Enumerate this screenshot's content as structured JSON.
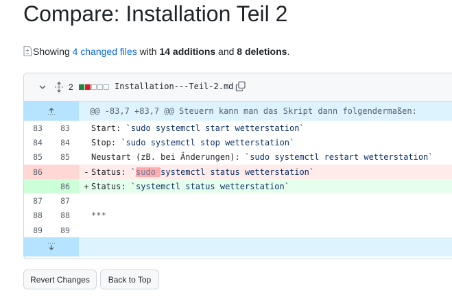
{
  "title": "Compare: Installation Teil 2",
  "summary": {
    "showing": "Showing",
    "changed_files": "4 changed files",
    "with": "with",
    "additions": "14 additions",
    "and": "and",
    "deletions": "8 deletions",
    "period": "."
  },
  "file": {
    "count": "2",
    "name": "Installation---Teil-2.md",
    "diffstat": [
      "add",
      "del",
      "neutral",
      "neutral",
      "neutral"
    ]
  },
  "hunk_header": "@@ -83,7 +83,7 @@ Steuern kann man das Skript dann folgendermaßen:",
  "lines": [
    {
      "type": "context",
      "old": "83",
      "new": "83",
      "sign": " ",
      "pre": "Start: ",
      "code": "`sudo systemctl start wetterstation`"
    },
    {
      "type": "context",
      "old": "84",
      "new": "84",
      "sign": " ",
      "pre": "Stop: ",
      "code": "`sudo systemctl stop wetterstation`"
    },
    {
      "type": "context",
      "old": "85",
      "new": "85",
      "sign": " ",
      "pre": "Neustart (zB. bei Änderungen): ",
      "code": "`sudo systemctl restart wetterstation`"
    },
    {
      "type": "del",
      "old": "86",
      "new": "",
      "sign": "-",
      "pre": "Status: ",
      "code_a": "`",
      "code_hl": "sudo ",
      "code_b": "systemctl status wetterstation`"
    },
    {
      "type": "add",
      "old": "",
      "new": "86",
      "sign": "+",
      "pre": "Status: ",
      "code": "`systemctl status wetterstation`"
    },
    {
      "type": "context",
      "old": "87",
      "new": "87",
      "sign": " ",
      "pre": "",
      "code": ""
    },
    {
      "type": "context",
      "old": "88",
      "new": "88",
      "sign": " ",
      "pre": "***",
      "code": ""
    },
    {
      "type": "context",
      "old": "89",
      "new": "89",
      "sign": " ",
      "pre": "",
      "code": ""
    }
  ],
  "buttons": {
    "revert": "Revert Changes",
    "back": "Back to Top"
  },
  "colors": {
    "link": "#0969da",
    "add_bg": "#e6ffec",
    "del_bg": "#ffebe9",
    "hunk_bg": "#ddf4ff"
  }
}
